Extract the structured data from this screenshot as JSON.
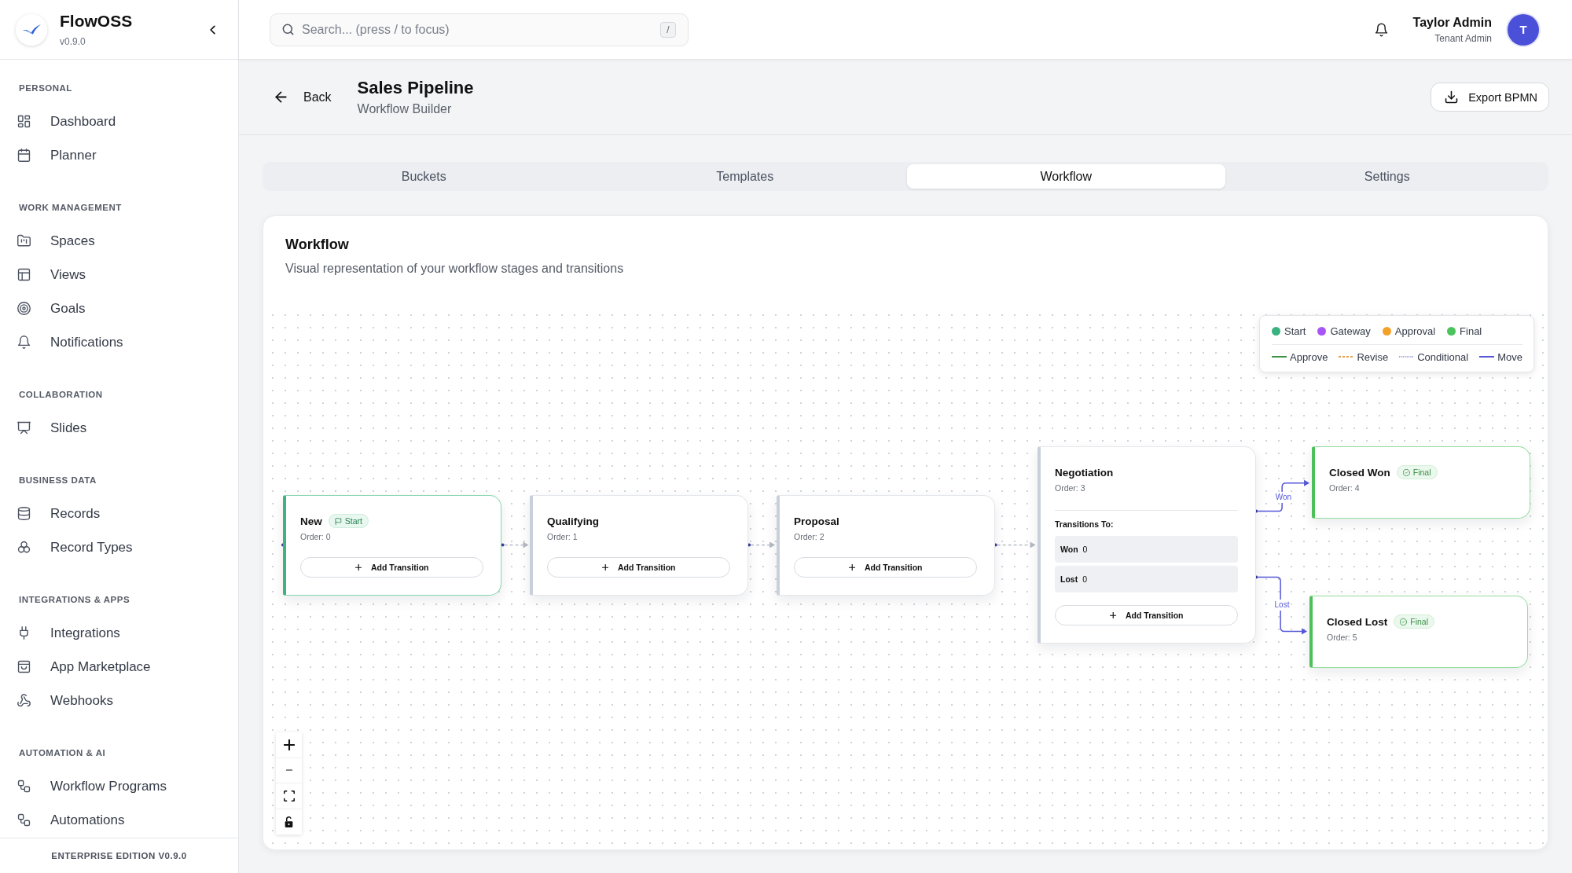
{
  "sidebar": {
    "brand": {
      "name": "FlowOSS",
      "version": "v0.9.0"
    },
    "sections": [
      {
        "title": "PERSONAL",
        "items": [
          {
            "label": "Dashboard",
            "selected": false
          },
          {
            "label": "Planner",
            "selected": false
          }
        ]
      },
      {
        "title": "WORK MANAGEMENT",
        "items": [
          {
            "label": "Spaces",
            "selected": false
          },
          {
            "label": "Views",
            "selected": false
          },
          {
            "label": "Goals",
            "selected": false
          },
          {
            "label": "Notifications",
            "selected": false
          }
        ]
      },
      {
        "title": "COLLABORATION",
        "items": [
          {
            "label": "Slides",
            "selected": false
          }
        ]
      },
      {
        "title": "BUSINESS DATA",
        "items": [
          {
            "label": "Records",
            "selected": false
          },
          {
            "label": "Record Types",
            "selected": false
          }
        ]
      },
      {
        "title": "INTEGRATIONS & APPS",
        "items": [
          {
            "label": "Integrations",
            "selected": false
          },
          {
            "label": "App Marketplace",
            "selected": false
          },
          {
            "label": "Webhooks",
            "selected": false
          }
        ]
      },
      {
        "title": "AUTOMATION & AI",
        "items": [
          {
            "label": "Workflow Programs",
            "selected": false
          },
          {
            "label": "Automations",
            "selected": false
          }
        ]
      }
    ],
    "footer": "ENTERPRISE EDITION V0.9.0"
  },
  "top_bar": {
    "search": {
      "placeholder": "Search... (press / to focus)",
      "shortcut": "/"
    },
    "user": {
      "name": "Taylor Admin",
      "role": "Tenant Admin",
      "initial": "T"
    }
  },
  "page_header": {
    "back_label": "Back",
    "title": "Sales Pipeline",
    "subtitle": "Workflow Builder",
    "export_button": "Export BPMN"
  },
  "tabs": [
    {
      "label": "Buckets",
      "selected": false
    },
    {
      "label": "Templates",
      "selected": false
    },
    {
      "label": "Workflow",
      "selected": true
    },
    {
      "label": "Settings",
      "selected": false
    }
  ],
  "workflow": {
    "title": "Workflow",
    "description": "Visual representation of your workflow stages and transitions",
    "legend": {
      "node_types": [
        {
          "label": "Start",
          "color": "#38b27f"
        },
        {
          "label": "Gateway",
          "color": "#a855f7"
        },
        {
          "label": "Approval",
          "color": "#f4a12a"
        },
        {
          "label": "Final",
          "color": "#4cc35c"
        }
      ],
      "transition_types": [
        {
          "label": "Approve",
          "color": "#3b9444",
          "kind": "solid"
        },
        {
          "label": "Revise",
          "color": "#e6a04a",
          "kind": "dashed"
        },
        {
          "label": "Conditional",
          "color": "#9aa4d6",
          "kind": "dotted"
        },
        {
          "label": "Move",
          "color": "#5557d8",
          "kind": "solid"
        }
      ]
    },
    "stages": [
      {
        "name": "New",
        "order": "Order: 0",
        "kind": "start",
        "badge": "Start",
        "add_button": "Add Transition"
      },
      {
        "name": "Qualifying",
        "order": "Order: 1",
        "kind": "stage",
        "add_button": "Add Transition"
      },
      {
        "name": "Proposal",
        "order": "Order: 2",
        "kind": "stage",
        "add_button": "Add Transition"
      },
      {
        "name": "Negotiation",
        "order": "Order: 3",
        "kind": "stage",
        "transitions_heading": "Transitions To:",
        "transitions": [
          {
            "label": "Won",
            "count": "0"
          },
          {
            "label": "Lost",
            "count": "0"
          }
        ],
        "add_button": "Add Transition"
      },
      {
        "name": "Closed Won",
        "order": "Order: 4",
        "kind": "final",
        "badge": "Final"
      },
      {
        "name": "Closed Lost",
        "order": "Order: 5",
        "kind": "final",
        "badge": "Final"
      }
    ],
    "connections": [
      {
        "kind": "conditional"
      },
      {
        "kind": "conditional"
      },
      {
        "kind": "conditional"
      },
      {
        "kind": "move",
        "label": "Won"
      },
      {
        "kind": "move",
        "label": "Lost"
      }
    ],
    "canvas_controls": {
      "locked": false
    }
  }
}
